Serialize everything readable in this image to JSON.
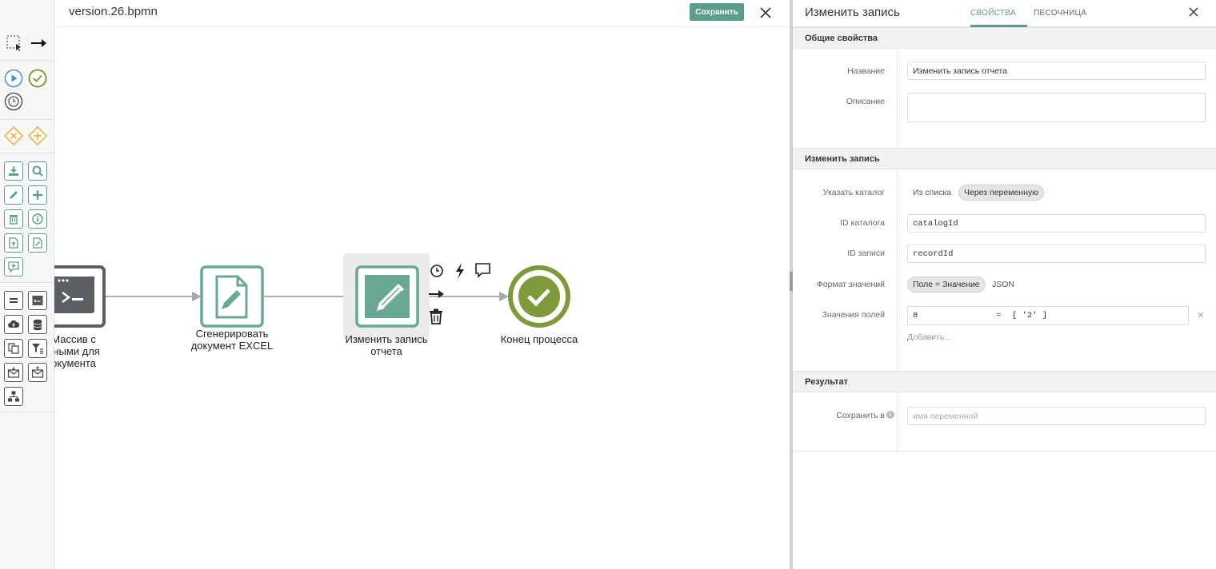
{
  "canvas": {
    "file_name": "version.26.bpmn",
    "save_label": "Сохранить",
    "nodes": [
      {
        "id": "script",
        "label_lines": [
          "Массив с",
          "нными для",
          "окумента"
        ]
      },
      {
        "id": "gen_excel",
        "label_lines": [
          "Сгенерировать",
          "документ EXCEL"
        ]
      },
      {
        "id": "edit_record",
        "label_lines": [
          "Изменить запись",
          "отчета"
        ]
      },
      {
        "id": "end",
        "label_lines": [
          "Конец процесса"
        ]
      }
    ]
  },
  "panel": {
    "title": "Изменить запись",
    "tabs": [
      {
        "label": "СВОЙСТВА",
        "active": true
      },
      {
        "label": "ПЕСОЧНИЦА",
        "active": false
      }
    ],
    "sections": {
      "general": {
        "title": "Общие свойства",
        "name_label": "Название",
        "name_value": "Изменить запись отчета",
        "description_label": "Описание",
        "description_value": ""
      },
      "edit": {
        "title": "Изменить запись",
        "catalog_label": "Указать каталог",
        "catalog_options": [
          "Из списка",
          "Через переменную"
        ],
        "catalog_selected": "Через переменную",
        "catalog_id_label": "ID каталога",
        "catalog_id_value": "catalogId",
        "record_id_label": "ID записи",
        "record_id_value": "recordId",
        "format_label": "Формат значений",
        "format_options": [
          "Поле = Значение",
          "JSON"
        ],
        "format_selected": "Поле = Значение",
        "fields_label": "Значения полей",
        "field_key": "8",
        "field_eq": "=",
        "field_value": "[ '2' ]",
        "add_label": "Добавить..."
      },
      "result": {
        "title": "Результат",
        "save_to_label": "Сохранить в",
        "save_to_placeholder": "имя переменной"
      }
    }
  },
  "colors": {
    "accent": "#5a9c8d",
    "task_border": "#6aa896",
    "end_event": "#7f9a3a",
    "script_task": "#5b5f63",
    "flow": "#b0b0b0"
  }
}
